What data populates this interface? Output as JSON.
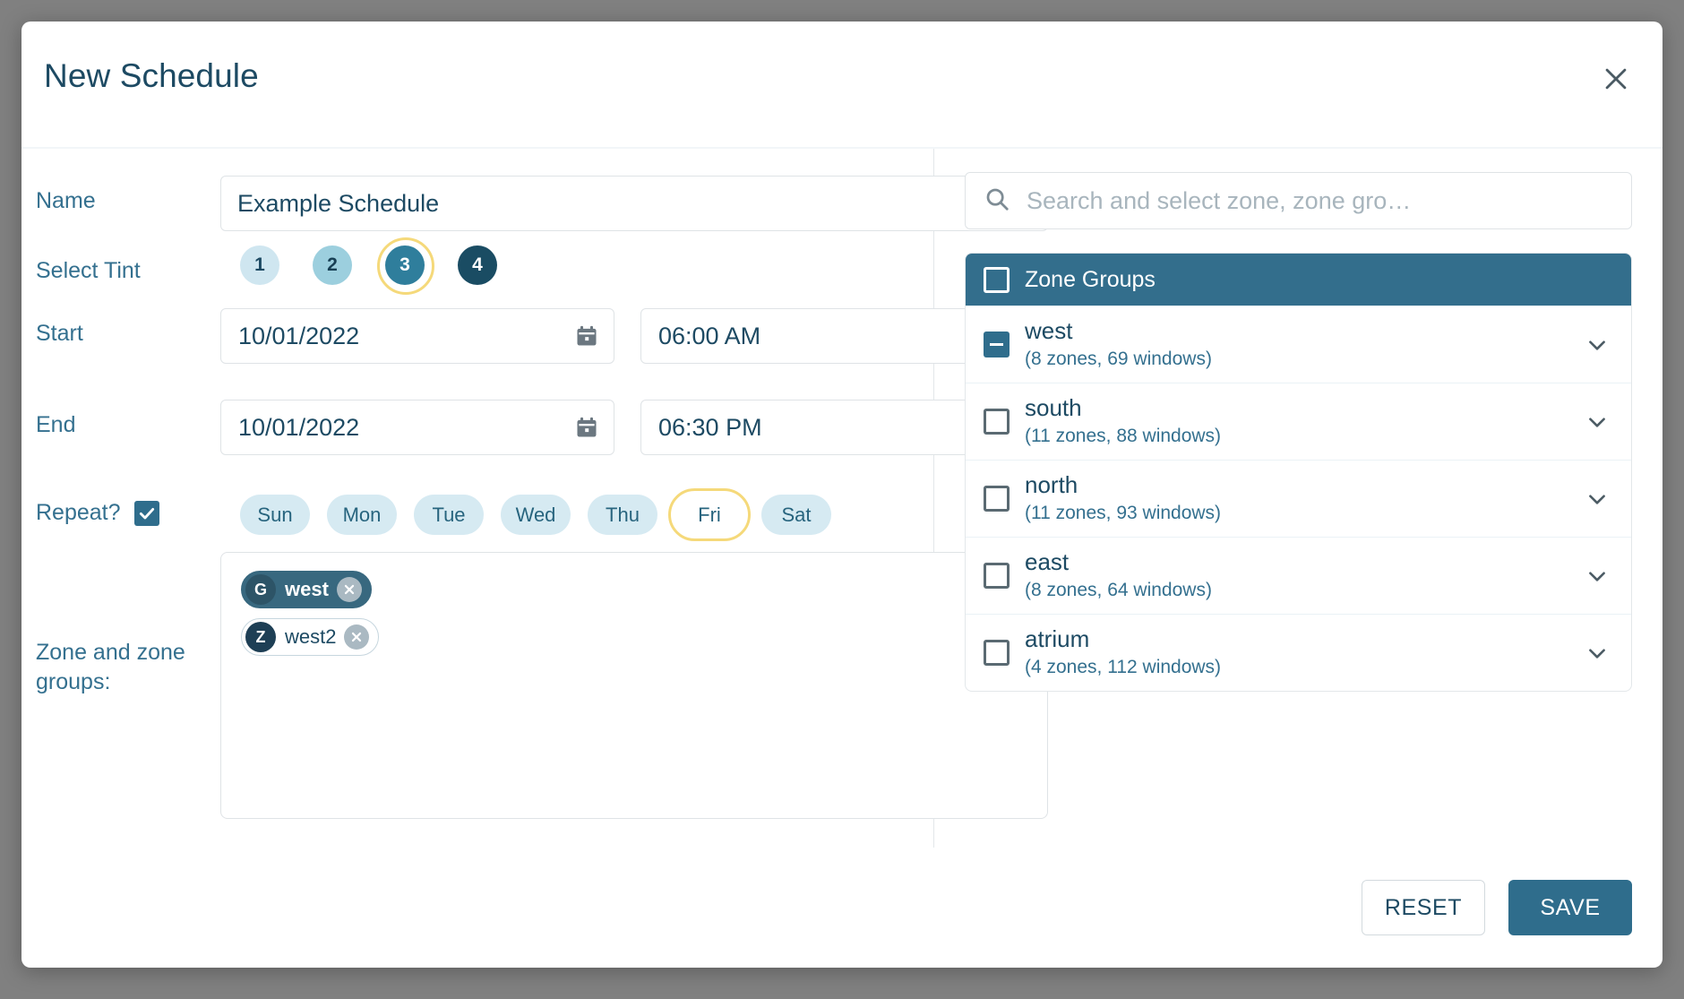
{
  "dialog": {
    "title": "New Schedule",
    "close_icon": "close-icon"
  },
  "form": {
    "name": {
      "label": "Name",
      "value": "Example Schedule"
    },
    "tint": {
      "label": "Select Tint",
      "selected": 3,
      "options": [
        {
          "label": "1",
          "color": "#cfe6f0",
          "text_color": "#1d4a63"
        },
        {
          "label": "2",
          "color": "#9ccfde",
          "text_color": "#173f54"
        },
        {
          "label": "3",
          "color": "#2f7e9c",
          "text_color": "#ffffff"
        },
        {
          "label": "4",
          "color": "#1a4c63",
          "text_color": "#ffffff"
        }
      ]
    },
    "start": {
      "label": "Start",
      "date": "10/01/2022",
      "time": "06:00 AM"
    },
    "end": {
      "label": "End",
      "date": "10/01/2022",
      "time": "06:30 PM"
    },
    "repeat": {
      "label": "Repeat?",
      "checked": true,
      "selected_day": "Fri",
      "days": [
        "Sun",
        "Mon",
        "Tue",
        "Wed",
        "Thu",
        "Fri",
        "Sat"
      ]
    },
    "zones": {
      "label": "Zone and zone groups:",
      "chips": [
        {
          "avatar": "G",
          "text": "west",
          "style": "filled"
        },
        {
          "avatar": "Z",
          "text": "west2",
          "style": "outline"
        }
      ]
    }
  },
  "panel": {
    "search": {
      "placeholder": "Search and select zone, zone gro…",
      "value": ""
    },
    "tree": {
      "header": {
        "label": "Zone Groups",
        "checkbox": "unchecked"
      },
      "rows": [
        {
          "name": "west",
          "sub": "(8 zones, 69 windows)",
          "checkbox": "indeterminate"
        },
        {
          "name": "south",
          "sub": "(11 zones, 88 windows)",
          "checkbox": "unchecked"
        },
        {
          "name": "north",
          "sub": "(11 zones, 93 windows)",
          "checkbox": "unchecked"
        },
        {
          "name": "east",
          "sub": "(8 zones, 64 windows)",
          "checkbox": "unchecked"
        },
        {
          "name": "atrium",
          "sub": "(4 zones, 112 windows)",
          "checkbox": "unchecked"
        }
      ]
    }
  },
  "footer": {
    "reset_label": "RESET",
    "save_label": "SAVE"
  },
  "colors": {
    "accent": "#2f6d8c",
    "header_bar": "#336E8C",
    "focus_ring": "#f5d97a",
    "label_text": "#34708f",
    "backdrop": "#808080"
  }
}
